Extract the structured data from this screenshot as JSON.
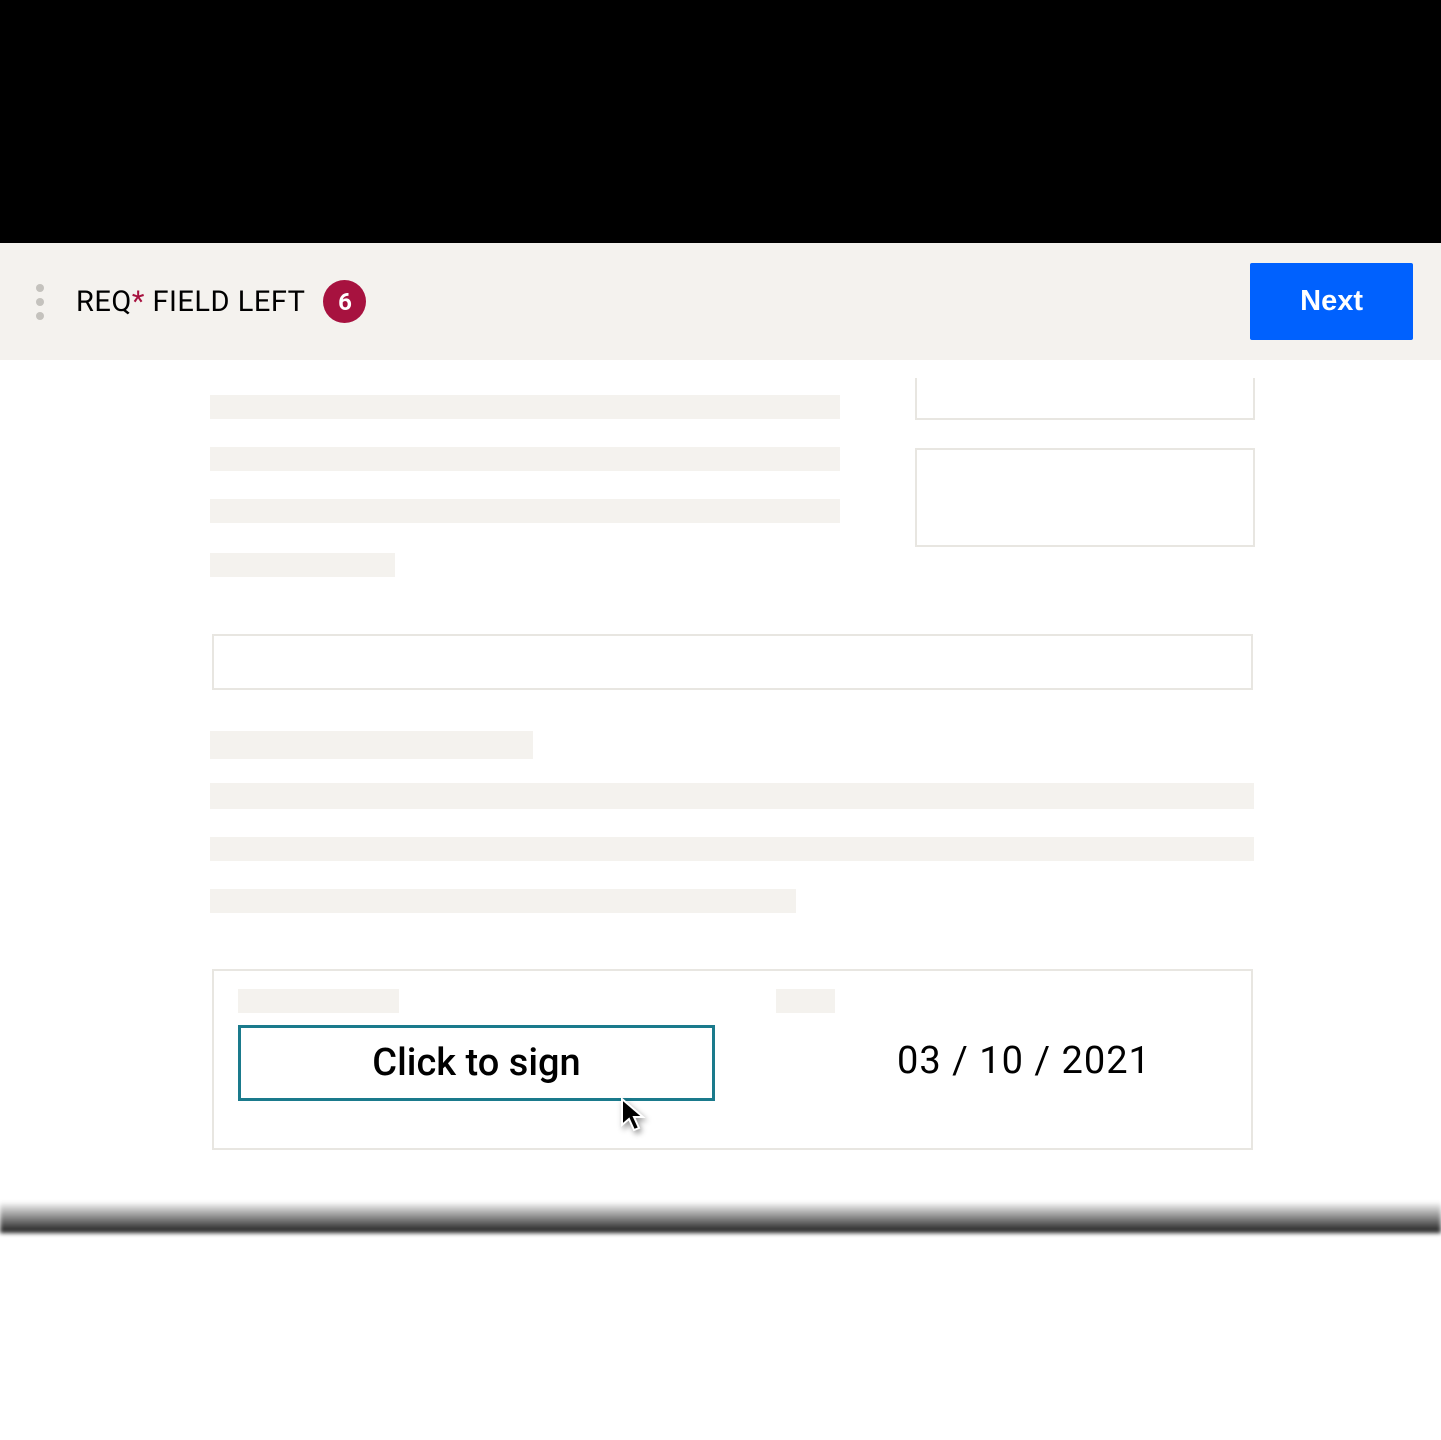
{
  "header": {
    "req_prefix": "REQ",
    "req_asterisk": "*",
    "req_suffix": " FIELD LEFT",
    "count": "6",
    "next_label": "Next"
  },
  "colors": {
    "accent_blue": "#0061fe",
    "badge_red": "#a7123f",
    "sign_border": "#1a7a8c",
    "placeholder_bg": "#f4f2ee"
  },
  "signature": {
    "sign_button_label": "Click to sign",
    "date_value": "03 / 10 / 2021"
  }
}
